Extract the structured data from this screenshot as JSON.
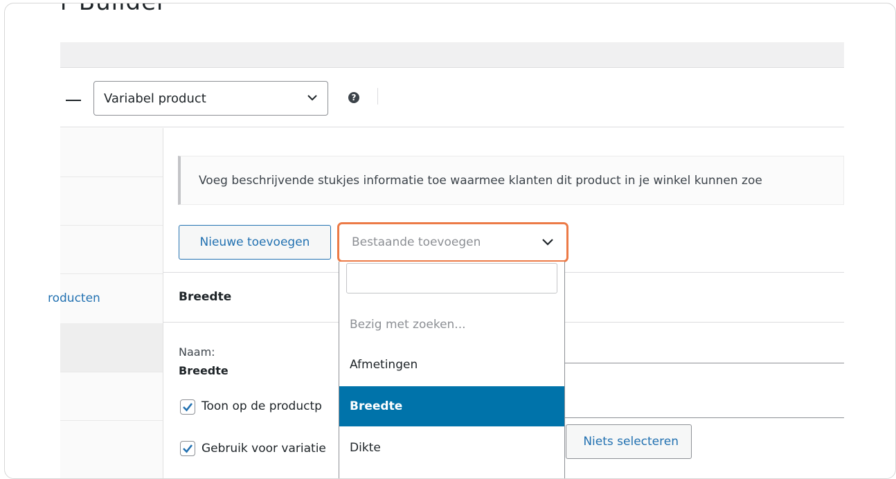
{
  "header": {
    "partial_title": "r Builder"
  },
  "product_type": {
    "value": "Variabel product",
    "help_icon": "question-circle-icon"
  },
  "sidebar": {
    "partial_link": "roducten"
  },
  "attributes": {
    "info_text": "Voeg beschrijvende stukjes informatie toe waarmee klanten dit product in je winkel kunnen zoe",
    "add_new_label": "Nieuwe toevoegen",
    "add_existing_placeholder": "Bestaande toevoegen",
    "attribute_title": "Breedte",
    "name_label": "Naam:",
    "name_value": "Breedte",
    "show_on_product_label": "Toon op de productp",
    "show_on_product_checked": true,
    "use_for_variations_label": "Gebruik voor variatie",
    "use_for_variations_checked": true,
    "select_none_label": "Niets selecteren"
  },
  "dropdown": {
    "search_value": "",
    "status_text": "Bezig met zoeken...",
    "options": [
      "Afmetingen",
      "Breedte",
      "Dikte"
    ],
    "selected": "Breedte"
  },
  "colors": {
    "link": "#2271b1",
    "highlight": "#0073aa",
    "focus_outline": "#ec7a46"
  }
}
